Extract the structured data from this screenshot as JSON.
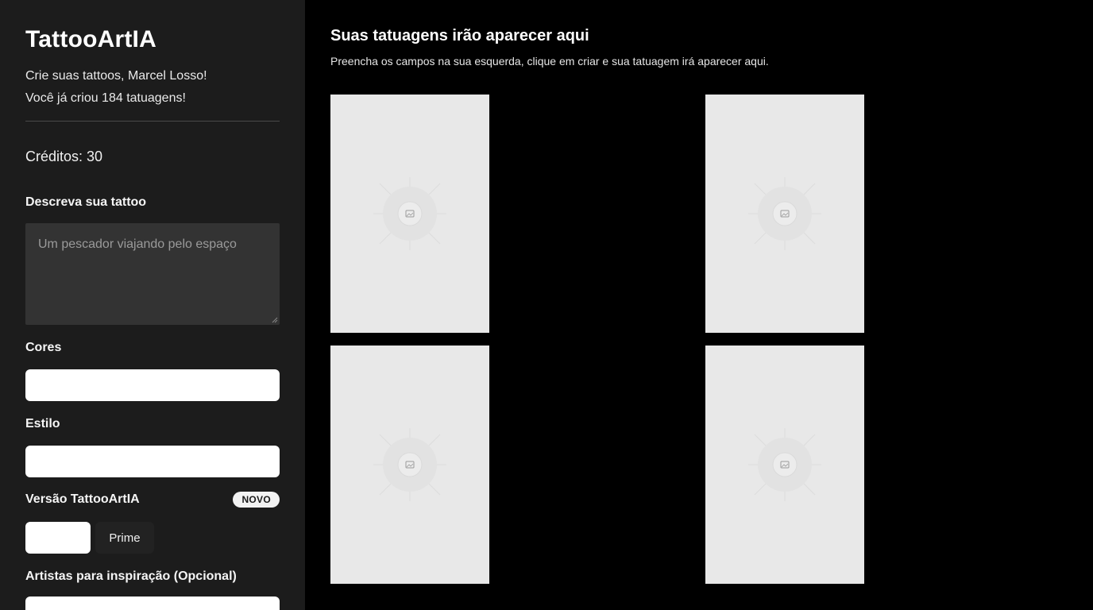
{
  "sidebar": {
    "brand": "TattooArtIA",
    "greeting": "Crie suas tattoos, Marcel Losso!",
    "count_text": "Você já criou 184 tatuagens!",
    "credits": "Créditos: 30",
    "describe_label": "Descreva sua tattoo",
    "describe_placeholder": "Um pescador viajando pelo espaço",
    "colors_label": "Cores",
    "colors_value": "",
    "style_label": "Estilo",
    "style_value": "",
    "version_label": "Versão TattooArtIA",
    "version_badge": "NOVO",
    "version_options": [
      "",
      "Prime"
    ],
    "artists_label": "Artistas para inspiração (Opcional)",
    "artists_value": ""
  },
  "main": {
    "title": "Suas tatuagens irão aparecer aqui",
    "subtitle": "Preencha os campos na sua esquerda, clique em criar e sua tatuagem irá aparecer aqui.",
    "placeholders": [
      {
        "icon": "image-placeholder-icon"
      },
      {
        "icon": "image-placeholder-icon"
      },
      {
        "icon": "image-placeholder-icon"
      },
      {
        "icon": "image-placeholder-icon"
      }
    ]
  },
  "colors": {
    "sidebar_bg": "#1c1c1c",
    "main_bg": "#000000",
    "input_bg": "#ffffff",
    "textarea_bg": "#333333",
    "placeholder_card_bg": "#e8e8e8"
  }
}
